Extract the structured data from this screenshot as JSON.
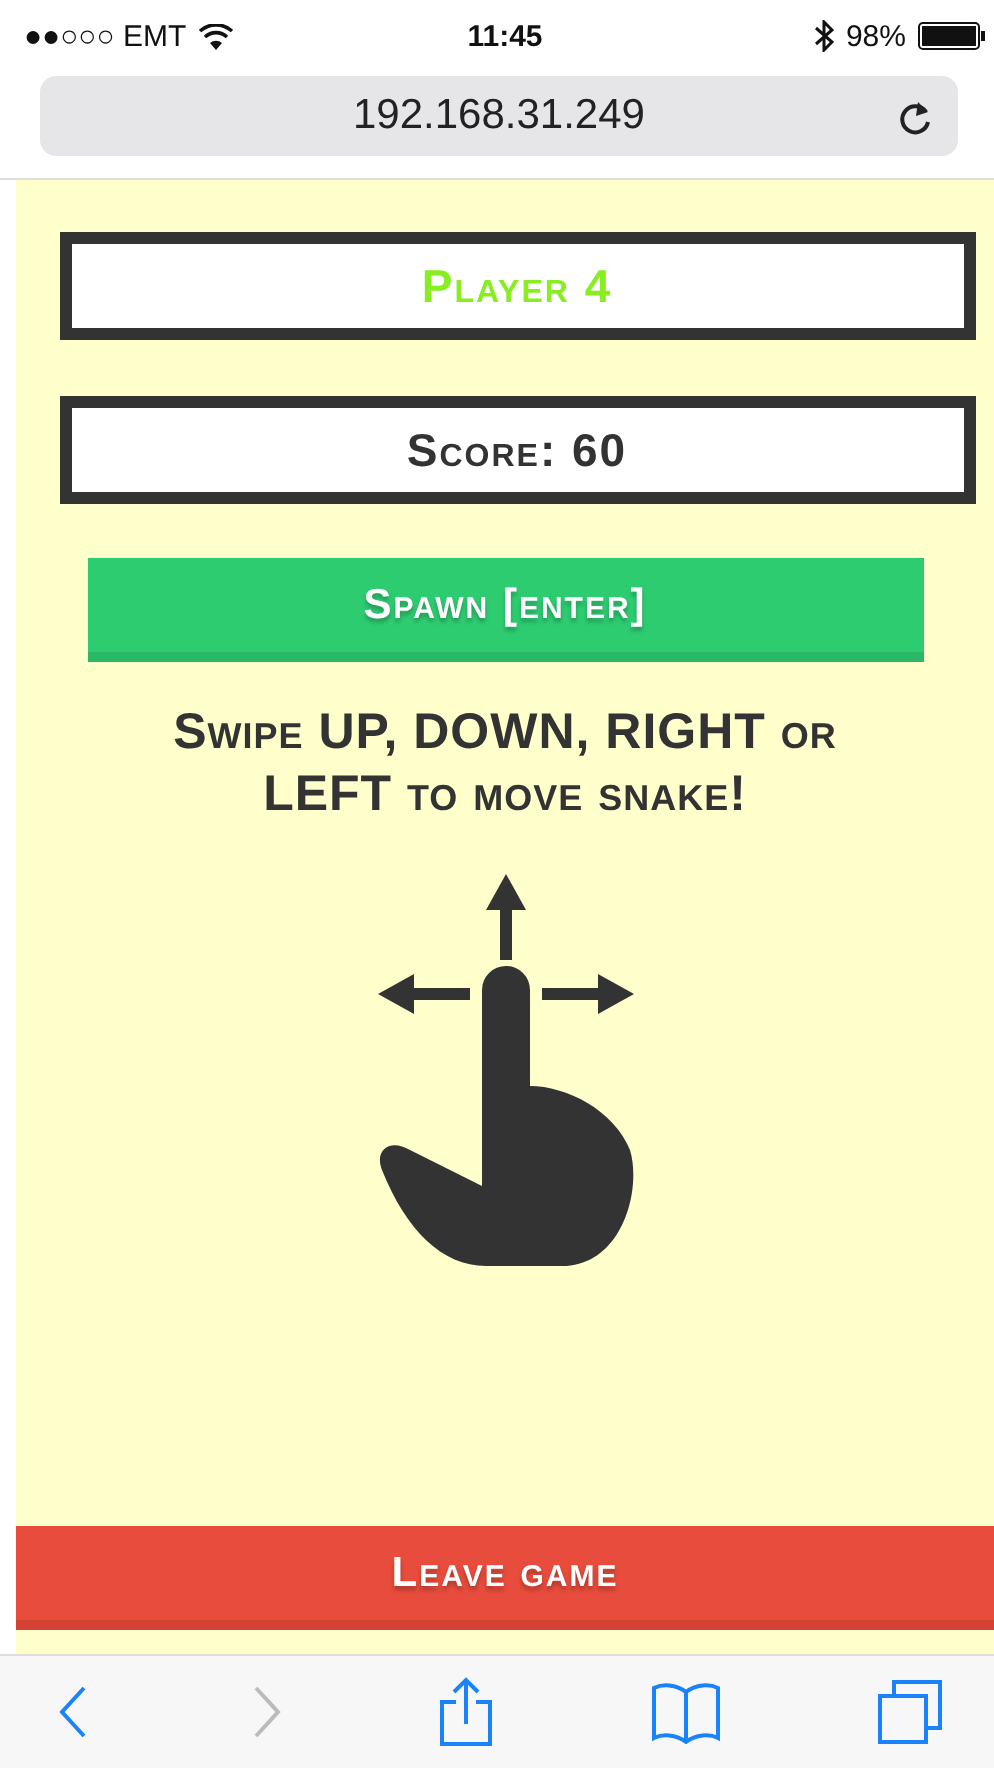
{
  "status_bar": {
    "carrier": "●●○○○ EMT",
    "time": "11:45",
    "battery": "98%"
  },
  "address_bar": {
    "url": "192.168.31.249"
  },
  "player": {
    "label": "Player 4"
  },
  "score": {
    "label": "Score: 60"
  },
  "spawn_button": "Spawn [enter]",
  "instructions": "Swipe UP, DOWN, RIGHT or LEFT to move snake!",
  "leave_button": "Leave game",
  "toolbar": [
    {
      "kind": "back",
      "disabled": false
    },
    {
      "kind": "forward",
      "disabled": true
    },
    {
      "kind": "share",
      "disabled": false
    },
    {
      "kind": "bookmarks",
      "disabled": false
    },
    {
      "kind": "tabs",
      "disabled": false
    }
  ]
}
